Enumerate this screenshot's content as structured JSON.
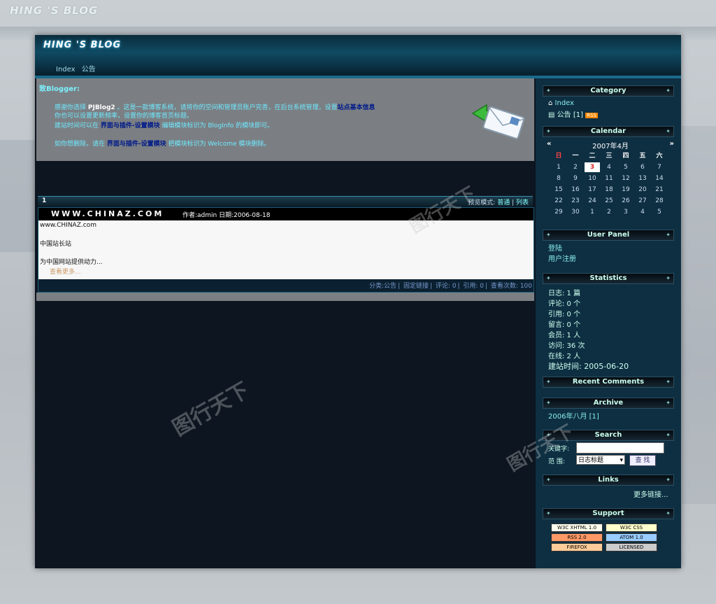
{
  "bg_title": "HING 'S BLOG",
  "header": {
    "logo": "HING 'S BLOG"
  },
  "nav": {
    "items": [
      "Index",
      "公告"
    ]
  },
  "notice": {
    "title": "致Blogger:",
    "lines": [
      {
        "pre": "感谢你选择 ",
        "bold": "PJBlog2",
        "mid": " 。这是一款博客系统，请将你的空间和管理员账户完善，在后台系统管理，设置",
        "link": "站点基本信息",
        "post": ""
      },
      {
        "pre": "你也可以设置更新频率，设置你的博客首页标题。",
        "bold": "",
        "mid": "",
        "link": "",
        "post": ""
      },
      {
        "pre": "建站时间可以在 ",
        "bold": "",
        "mid": "",
        "link": "界面与插件-设置模块",
        "post": " 编辑模块标识为 BlogInfo 的模块即可。"
      },
      {
        "pre": "如你想删除，请在 ",
        "bold": "",
        "mid": "",
        "link": "界面与插件-设置模块",
        "post": " 把模块标识为 Welcome 模块删除。"
      }
    ]
  },
  "post": {
    "number": "1",
    "mode_label": "预览模式:",
    "mode_normal": "普通",
    "mode_list": "列表",
    "site": "WWW.CHINAZ.COM",
    "meta": "作者:admin 日期:2006-08-18",
    "body": [
      "www.CHINAZ.com",
      "中国站长站",
      "为中国网站提供动力...",
      "查看更多..."
    ],
    "footer": [
      "分类:公告",
      "固定链接",
      "评论: 0",
      "引用: 0",
      "查看次数: 100"
    ]
  },
  "sidebar": {
    "category_title": "Category",
    "category_items": [
      "Index",
      "公告 [1]"
    ],
    "calendar_title": "Calendar",
    "calendar_month": "2007年4月",
    "calendar_prev": "«",
    "calendar_next": "»",
    "calendar_weekdays": [
      "日",
      "一",
      "二",
      "三",
      "四",
      "五",
      "六"
    ],
    "calendar_days": [
      [
        "1",
        "2",
        "3",
        "4",
        "5",
        "6",
        "7"
      ],
      [
        "8",
        "9",
        "10",
        "11",
        "12",
        "13",
        "14"
      ],
      [
        "15",
        "16",
        "17",
        "18",
        "19",
        "20",
        "21"
      ],
      [
        "22",
        "23",
        "24",
        "25",
        "26",
        "27",
        "28"
      ],
      [
        "29",
        "30",
        "1",
        "2",
        "3",
        "4",
        "5"
      ]
    ],
    "calendar_today": "3",
    "userpanel_title": "User Panel",
    "userpanel_items": [
      "登陆",
      "用户注册"
    ],
    "stats_title": "Statistics",
    "stats": [
      "日志: 1 篇",
      "评论: 0 个",
      "引用: 0 个",
      "留言: 0 个",
      "会员: 1 人",
      "访问: 36 次",
      "在线: 2 人",
      "建站时间: 2005-06-20"
    ],
    "recent_title": "Recent Comments",
    "archive_title": "Archive",
    "archive_items": [
      "2006年八月 [1]"
    ],
    "search_title": "Search",
    "search_label": "关键字:",
    "search_range_label": "范 围:",
    "search_select": "日志标题",
    "search_button": "查 找",
    "links_title": "Links",
    "links_more": "更多链接...",
    "support_title": "Support",
    "support_badges": [
      "W3C XHTML 1.0",
      "W3C CSS",
      "RSS 2.0",
      "ATOM 1.0",
      "FIREFOX",
      "LICENSED"
    ]
  },
  "colors": {
    "accent": "#6fe8ff",
    "header": "#0f4a63",
    "sidebar": "#0e2f42"
  }
}
